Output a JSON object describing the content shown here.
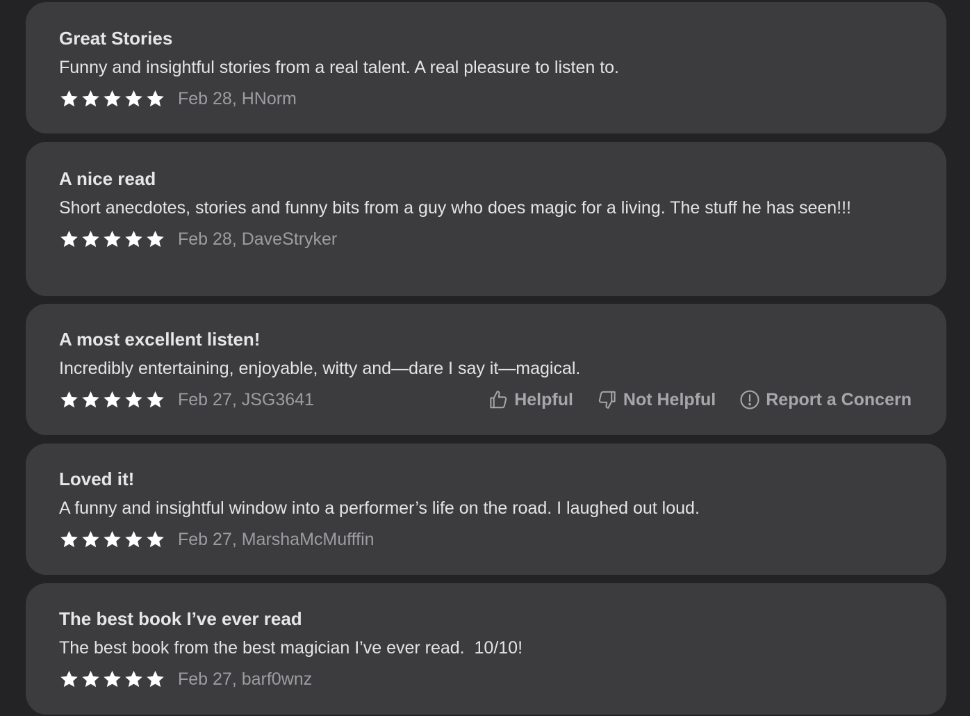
{
  "reviews": [
    {
      "title": "Great Stories",
      "body": "Funny and insightful stories from a real talent. A real pleasure to listen to.",
      "rating": 5,
      "meta": "Feb 28, HNorm"
    },
    {
      "title": "A nice read",
      "body": "Short anecdotes, stories and funny bits from a guy who does magic for a living. The stuff he has seen!!!",
      "rating": 5,
      "meta": "Feb 28, DaveStryker"
    },
    {
      "title": "A most excellent listen!",
      "body": "Incredibly entertaining, enjoyable, witty and—dare I say it—magical.",
      "rating": 5,
      "meta": "Feb 27, JSG3641",
      "actions": {
        "helpful_label": "Helpful",
        "not_helpful_label": "Not Helpful",
        "report_label": "Report a Concern"
      }
    },
    {
      "title": "Loved it!",
      "body": "A funny and insightful window into a performer’s life on the road. I laughed out loud.",
      "rating": 5,
      "meta": "Feb 27, MarshaMcMufffin"
    },
    {
      "title": "The best book I’ve ever read",
      "body": "The best book from the best magician I’ve ever read.  10/10!",
      "rating": 5,
      "meta": "Feb 27, barf0wnz"
    }
  ],
  "icons": {
    "star": "star-icon",
    "helpful": "thumbs-up-icon",
    "not_helpful": "thumbs-down-icon",
    "report": "exclamation-circle-icon"
  },
  "colors": {
    "background": "#232325",
    "card": "#3c3c3e",
    "title": "#e6e6e8",
    "body": "#e4e4e6",
    "meta": "#9d9da1",
    "star": "#ffffff",
    "action": "#a7a7ab"
  }
}
